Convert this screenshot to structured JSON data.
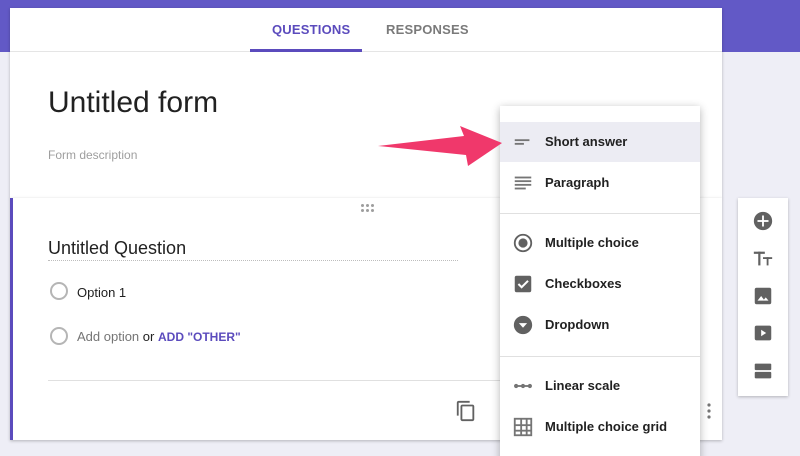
{
  "tabs": {
    "questions": "QUESTIONS",
    "responses": "RESPONSES"
  },
  "form": {
    "title": "Untitled form",
    "description_placeholder": "Form description"
  },
  "question": {
    "title": "Untitled Question",
    "option_1": "Option 1",
    "add_option": "Add option",
    "or": "or",
    "add_other": "ADD \"OTHER\""
  },
  "menu": {
    "items": [
      {
        "label": "Short answer",
        "icon": "short-answer-icon"
      },
      {
        "label": "Paragraph",
        "icon": "paragraph-icon"
      },
      {
        "label": "Multiple choice",
        "icon": "radio-button-icon"
      },
      {
        "label": "Checkboxes",
        "icon": "checkbox-icon"
      },
      {
        "label": "Dropdown",
        "icon": "dropdown-icon"
      },
      {
        "label": "Linear scale",
        "icon": "linear-scale-icon"
      },
      {
        "label": "Multiple choice grid",
        "icon": "grid-icon"
      }
    ],
    "selected": "Short answer"
  },
  "sidebar": {
    "icons": [
      "add-question-icon",
      "add-title-icon",
      "add-image-icon",
      "add-video-icon",
      "add-section-icon"
    ]
  },
  "colors": {
    "accent": "#5b4bbd",
    "header_band": "#6259c6",
    "arrow": "#f0386b"
  }
}
